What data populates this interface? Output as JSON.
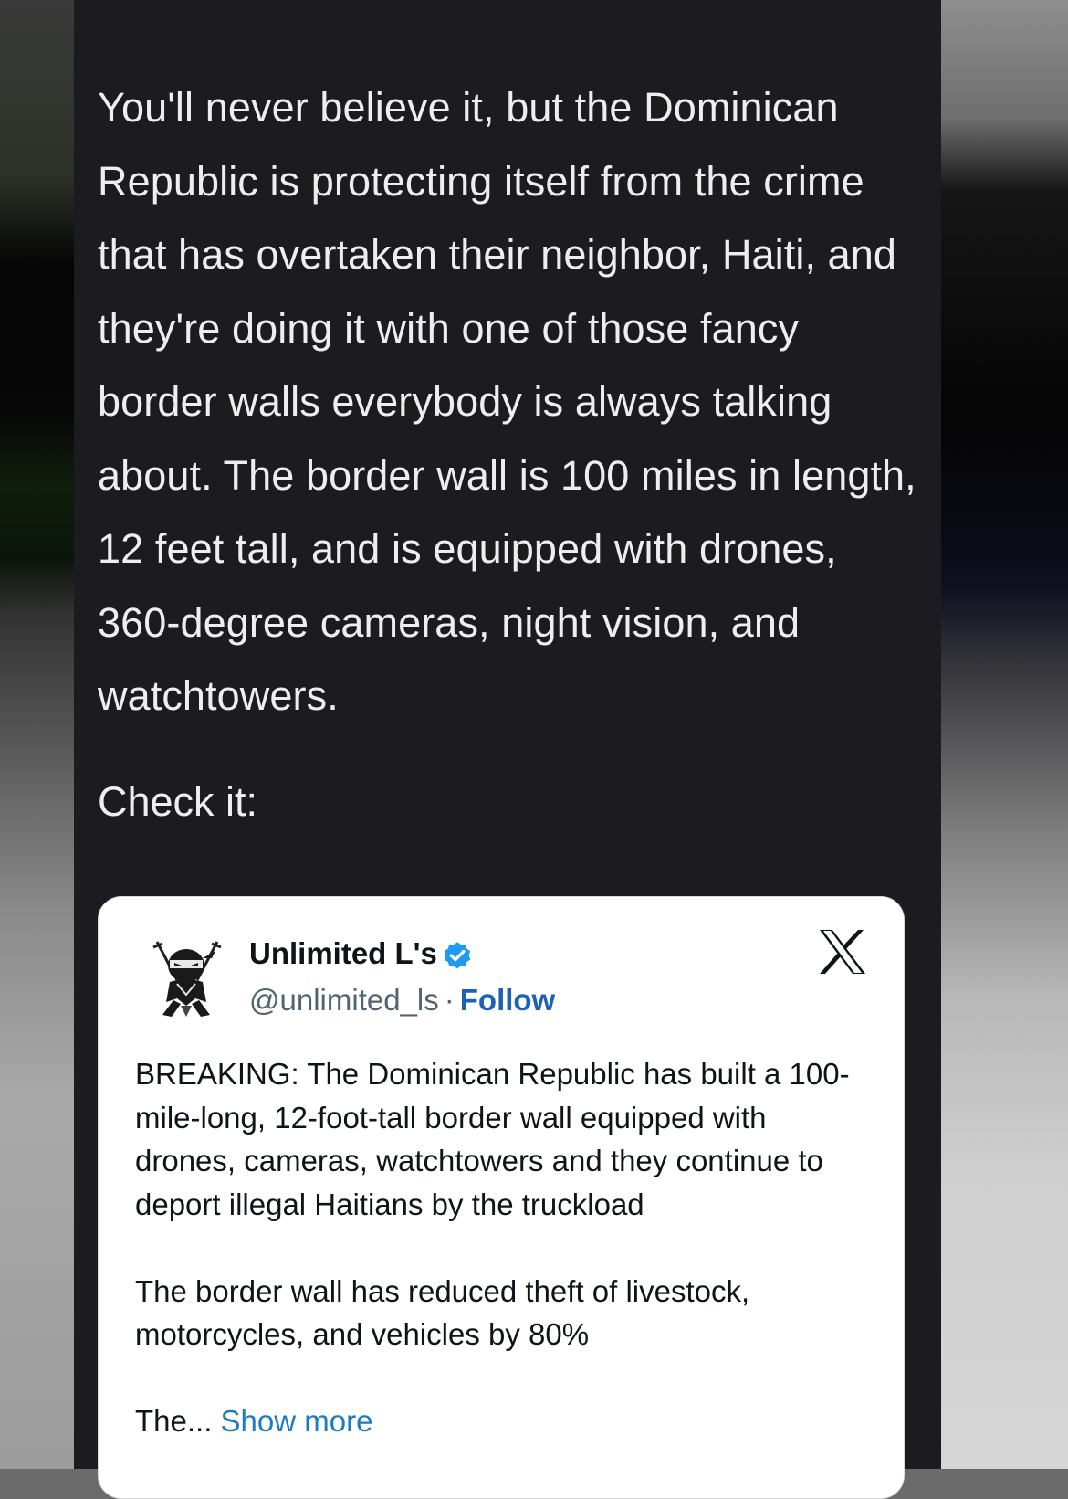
{
  "article": {
    "body_text": "You'll never believe it, but the Dominican Republic is protecting itself from the crime that has overtaken their neighbor, Haiti, and they're doing it with one of those fancy border walls everybody is always talking about. The border wall is 100 miles in length, 12 feet tall, and is equipped with drones, 360-degree cameras, night vision, and watchtowers.",
    "check_it": "Check it:"
  },
  "tweet": {
    "display_name": "Unlimited L's",
    "handle": "@unlimited_ls",
    "separator": "·",
    "follow_label": "Follow",
    "verified_icon": "verified-badge-icon",
    "platform_icon": "x-logo-icon",
    "paragraph_1": "BREAKING: The Dominican Republic has built a 100-mile-long, 12-foot-tall border wall equipped with drones, cameras, watchtowers and they continue to  deport illegal Haitians by the truckload",
    "paragraph_2": "The border wall has reduced theft of livestock, motorcycles, and vehicles by 80%",
    "truncated_text": "The...",
    "show_more_label": "Show more"
  },
  "colors": {
    "app_background": "#1c1b1f",
    "card_background": "#ffffff",
    "follow_color": "#1d62b8",
    "show_more_color": "#1d7bc0",
    "verified_color": "#1d9bf0"
  }
}
